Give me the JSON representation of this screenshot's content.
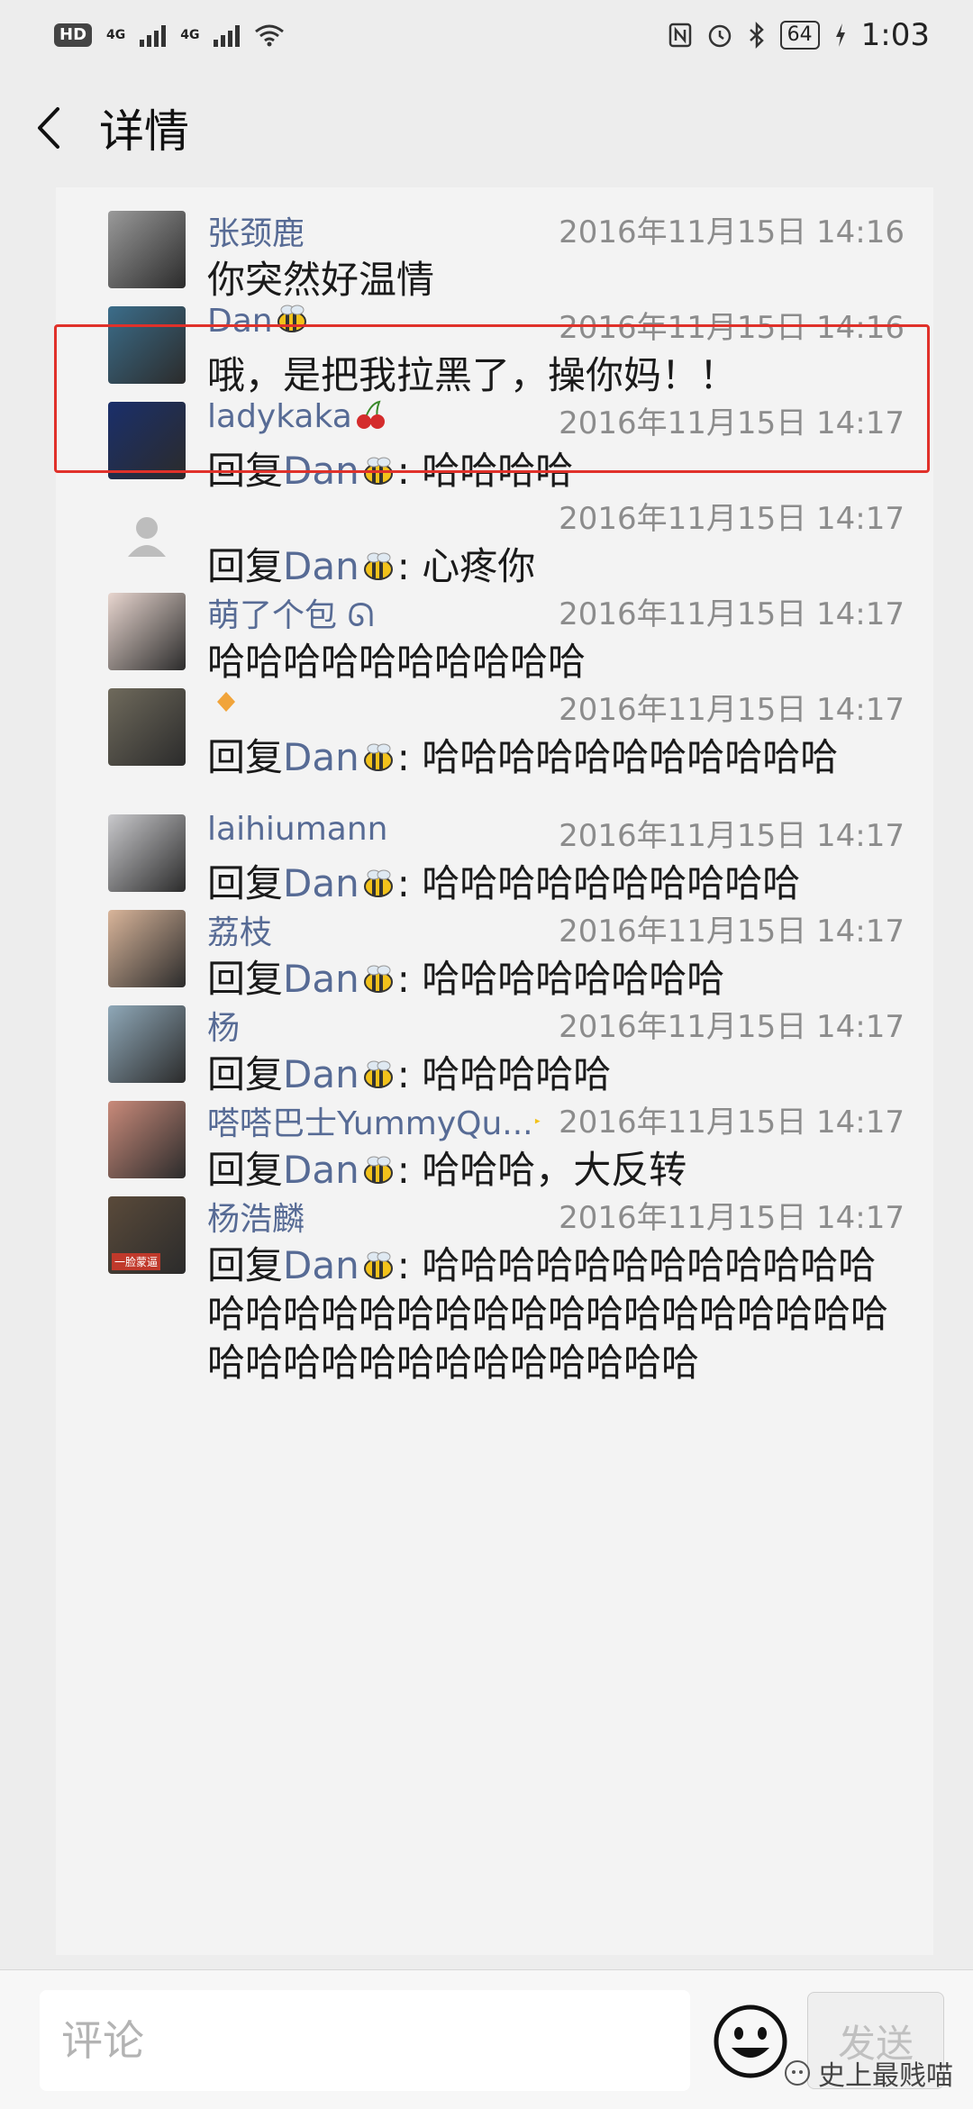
{
  "status_bar": {
    "hd": "HD",
    "signal1": "4G",
    "signal2": "4G",
    "battery": "64",
    "time": "1:03"
  },
  "header": {
    "title": "详情",
    "back_icon": "chevron-left-icon"
  },
  "reply_prefix": "回复",
  "reply_target": "Dan",
  "comments": [
    {
      "name": "张颈鹿",
      "time": "2016年11月15日 14:16",
      "reply": false,
      "text": "你突然好温情",
      "avatar_color": "#9a9a9a"
    },
    {
      "name": "Dan",
      "name_emoji": "bee",
      "time": "2016年11月15日 14:16",
      "reply": false,
      "text": "哦，是把我拉黑了，操你妈！！",
      "avatar_color": "#3b6d8a",
      "highlighted": true
    },
    {
      "name": "ladykaka",
      "name_emoji": "cherry",
      "time": "2016年11月15日 14:17",
      "reply": true,
      "text": ": 哈哈哈哈",
      "avatar_color": "#1a2f6b"
    },
    {
      "name": "",
      "time": "2016年11月15日 14:17",
      "reply": true,
      "text": ": 心疼你",
      "avatar_color": "#d8d8d8",
      "default_avatar": true
    },
    {
      "name": "萌了个包",
      "name_suffix": "ᘏ",
      "time": "2016年11月15日 14:17",
      "reply": false,
      "text": "哈哈哈哈哈哈哈哈哈哈",
      "avatar_color": "#e8d6cf"
    },
    {
      "name": "",
      "name_emoji": "diamond",
      "time": "2016年11月15日 14:17",
      "reply": true,
      "text": ": 哈哈哈哈哈哈哈哈哈哈哈",
      "avatar_color": "#6f6a5c"
    },
    {
      "name": "laihiumann",
      "time": "2016年11月15日 14:17",
      "reply": true,
      "text": ": 哈哈哈哈哈哈哈哈哈哈",
      "avatar_color": "#c9c9cc"
    },
    {
      "name": "荔枝",
      "time": "2016年11月15日 14:17",
      "reply": true,
      "text": ": 哈哈哈哈哈哈哈哈",
      "avatar_color": "#d9b59a"
    },
    {
      "name": "杨",
      "time": "2016年11月15日 14:17",
      "reply": true,
      "text": ": 哈哈哈哈哈",
      "avatar_color": "#8fa8b8"
    },
    {
      "name": "嗒嗒巴士YummyQu...",
      "name_emoji": "small-flag",
      "time": "2016年11月15日 14:17",
      "reply": true,
      "text": ": 哈哈哈，大反转",
      "avatar_color": "#c98a7a"
    },
    {
      "name": "杨浩麟",
      "time": "2016年11月15日 14:17",
      "reply": true,
      "text": ": 哈哈哈哈哈哈哈哈哈哈哈哈哈哈哈哈哈哈哈哈哈哈哈哈哈哈哈哈哈哈哈哈哈哈哈哈哈哈哈哈哈哈哈",
      "avatar_color": "#5a4a3a",
      "avatar_caption": "一脸蒙逼"
    }
  ],
  "bottom_bar": {
    "placeholder": "评论",
    "emoji_icon": "smiley-icon",
    "send_label": "发送"
  },
  "watermark": {
    "text": "史上最贱喵",
    "icon": "wechat-official-icon"
  },
  "colors": {
    "name_link": "#576b95",
    "highlight_border": "#e0312a",
    "background": "#ededed",
    "card": "#f3f3f3"
  }
}
